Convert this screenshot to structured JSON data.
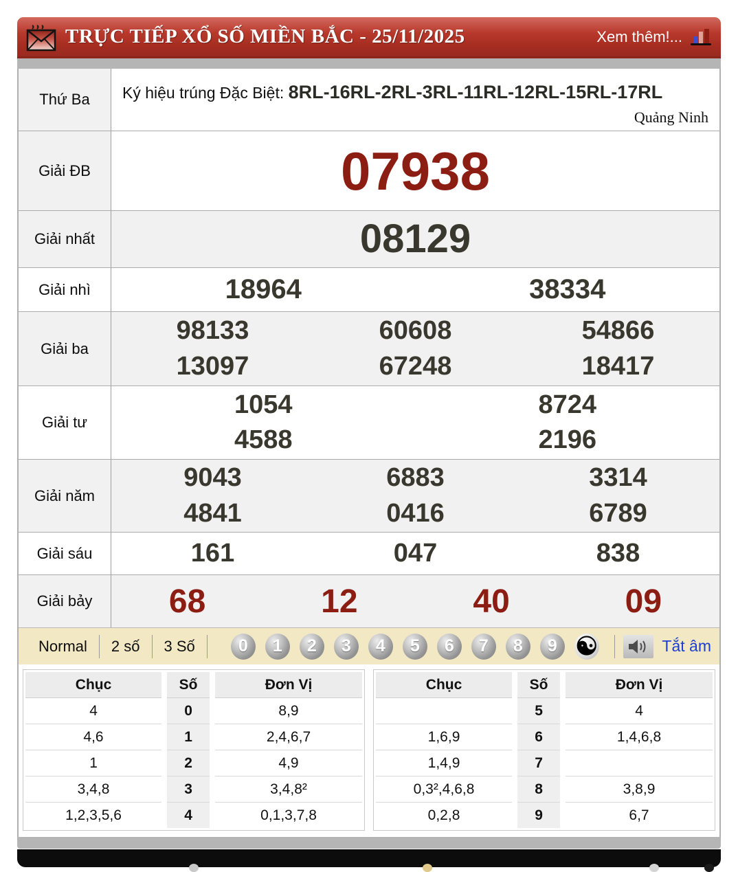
{
  "header": {
    "title": "TRỰC TIẾP XỔ SỐ MIỀN BẮC - 25/11/2025",
    "more_label": "Xem thêm!..."
  },
  "info_row": {
    "day": "Thứ Ba",
    "prefix": "Ký hiệu trúng Đặc Biệt: ",
    "codes": "8RL-16RL-2RL-3RL-11RL-12RL-15RL-17RL",
    "province": "Quảng Ninh"
  },
  "prizes": {
    "db": {
      "label": "Giải ĐB",
      "value": "07938"
    },
    "first": {
      "label": "Giải nhất",
      "value": "08129"
    },
    "second": {
      "label": "Giải nhì",
      "values": [
        "18964",
        "38334"
      ]
    },
    "third": {
      "label": "Giải ba",
      "values": [
        "98133",
        "60608",
        "54866",
        "13097",
        "67248",
        "18417"
      ]
    },
    "fourth": {
      "label": "Giải tư",
      "values": [
        "1054",
        "8724",
        "4588",
        "2196"
      ]
    },
    "fifth": {
      "label": "Giải năm",
      "values": [
        "9043",
        "6883",
        "3314",
        "4841",
        "0416",
        "6789"
      ]
    },
    "sixth": {
      "label": "Giải sáu",
      "values": [
        "161",
        "047",
        "838"
      ]
    },
    "seventh": {
      "label": "Giải bảy",
      "values": [
        "68",
        "12",
        "40",
        "09"
      ]
    }
  },
  "controls": {
    "modes": [
      "Normal",
      "2 số",
      "3 Số"
    ],
    "balls": [
      "0",
      "1",
      "2",
      "3",
      "4",
      "5",
      "6",
      "7",
      "8",
      "9"
    ],
    "yinyang": "☯",
    "mute_label": "Tắt âm"
  },
  "stats": {
    "left": {
      "headers": [
        "Chục",
        "Số",
        "Đơn Vị"
      ],
      "rows": [
        [
          "4",
          "0",
          "8,9"
        ],
        [
          "4,6",
          "1",
          "2,4,6,7"
        ],
        [
          "1",
          "2",
          "4,9"
        ],
        [
          "3,4,8",
          "3",
          "3,4,8²"
        ],
        [
          "1,2,3,5,6",
          "4",
          "0,1,3,7,8"
        ]
      ]
    },
    "right": {
      "headers": [
        "Chục",
        "Số",
        "Đơn Vị"
      ],
      "rows": [
        [
          "",
          "5",
          "4"
        ],
        [
          "1,6,9",
          "6",
          "1,4,6,8"
        ],
        [
          "1,4,9",
          "7",
          ""
        ],
        [
          "0,3²,4,6,8",
          "8",
          "3,8,9"
        ],
        [
          "0,2,8",
          "9",
          "6,7"
        ]
      ]
    }
  },
  "colors": {
    "header_red": "#a52c20",
    "accent_red": "#8b1d12",
    "number_dark": "#39382e",
    "control_bg": "#f2e8c4",
    "link_blue": "#1c3ed1"
  }
}
